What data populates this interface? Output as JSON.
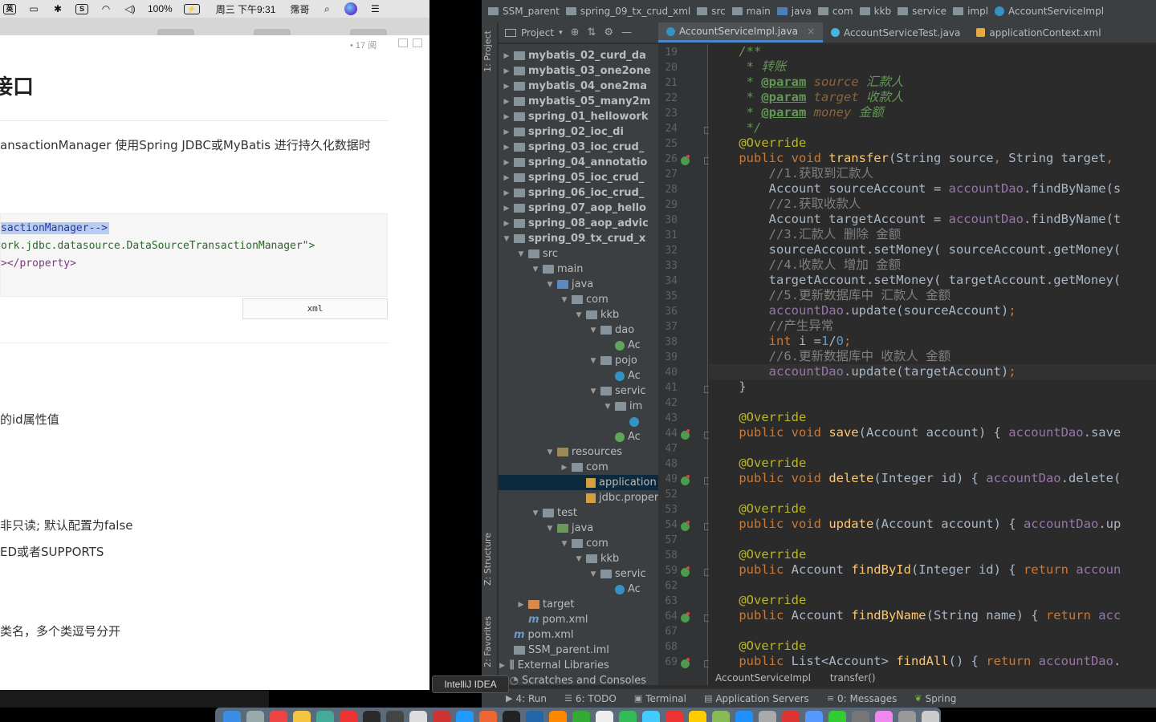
{
  "menubar": {
    "battery": "100%",
    "clock": "周三 下午9:31",
    "user": "霈哥",
    "icons": [
      "chinese-input-icon",
      "screen-icon",
      "bluetooth-icon",
      "s-app-icon",
      "wifi-icon",
      "volume-icon",
      "battery-icon",
      "search-icon",
      "siri-icon",
      "list-icon"
    ],
    "input_label": "英"
  },
  "doc": {
    "meta": "• 17 阅",
    "heading": "接口",
    "para1": "ansactionManager 使用Spring JDBC或MyBatis 进行持久化数据时",
    "code_lines": [
      "sactionManager-->",
      "ork.jdbc.datasource.DataSourceTransactionManager\">",
      "></property>"
    ],
    "code_lang": "xml",
    "para2": "的id属性值",
    "para3": "非只读; 默认配置为false",
    "para4": "ED或者SUPPORTS",
    "para5": "类名，多个类逗号分开"
  },
  "ide": {
    "breadcrumbs": [
      "SSM_parent",
      "spring_09_tx_crud_xml",
      "src",
      "main",
      "java",
      "com",
      "kkb",
      "service",
      "impl",
      "AccountServiceImpl"
    ],
    "project_label": "Project",
    "tabs": [
      {
        "label": "AccountServiceImpl.java",
        "active": true
      },
      {
        "label": "AccountServiceTest.java",
        "active": false
      },
      {
        "label": "applicationContext.xml",
        "active": false
      }
    ],
    "left_stripe": [
      "1: Project",
      "Z: Structure",
      "2: Favorites"
    ],
    "tree": [
      {
        "label": "mybatis_02_curd_da",
        "depth": 0,
        "arrow": "▶",
        "icon": "module"
      },
      {
        "label": "mybatis_03_one2one",
        "depth": 0,
        "arrow": "▶",
        "icon": "module"
      },
      {
        "label": "mybatis_04_one2ma",
        "depth": 0,
        "arrow": "▶",
        "icon": "module"
      },
      {
        "label": "mybatis_05_many2m",
        "depth": 0,
        "arrow": "▶",
        "icon": "module"
      },
      {
        "label": "spring_01_hellowork",
        "depth": 0,
        "arrow": "▶",
        "icon": "module"
      },
      {
        "label": "spring_02_ioc_di",
        "depth": 0,
        "arrow": "▶",
        "icon": "module"
      },
      {
        "label": "spring_03_ioc_crud_",
        "depth": 0,
        "arrow": "▶",
        "icon": "module"
      },
      {
        "label": "spring_04_annotatio",
        "depth": 0,
        "arrow": "▶",
        "icon": "module"
      },
      {
        "label": "spring_05_ioc_crud_",
        "depth": 0,
        "arrow": "▶",
        "icon": "module"
      },
      {
        "label": "spring_06_ioc_crud_",
        "depth": 0,
        "arrow": "▶",
        "icon": "module"
      },
      {
        "label": "spring_07_aop_hello",
        "depth": 0,
        "arrow": "▶",
        "icon": "module"
      },
      {
        "label": "spring_08_aop_advic",
        "depth": 0,
        "arrow": "▶",
        "icon": "module"
      },
      {
        "label": "spring_09_tx_crud_x",
        "depth": 0,
        "arrow": "▼",
        "icon": "module"
      },
      {
        "label": "src",
        "depth": 1,
        "arrow": "▼",
        "icon": "folder"
      },
      {
        "label": "main",
        "depth": 2,
        "arrow": "▼",
        "icon": "folder"
      },
      {
        "label": "java",
        "depth": 3,
        "arrow": "▼",
        "icon": "src"
      },
      {
        "label": "com",
        "depth": 4,
        "arrow": "▼",
        "icon": "pkg"
      },
      {
        "label": "kkb",
        "depth": 5,
        "arrow": "▼",
        "icon": "pkg"
      },
      {
        "label": "dao",
        "depth": 6,
        "arrow": "▼",
        "icon": "pkg"
      },
      {
        "label": "Ac",
        "depth": 7,
        "arrow": "",
        "icon": "interface"
      },
      {
        "label": "pojo",
        "depth": 6,
        "arrow": "▼",
        "icon": "pkg"
      },
      {
        "label": "Ac",
        "depth": 7,
        "arrow": "",
        "icon": "class"
      },
      {
        "label": "servic",
        "depth": 6,
        "arrow": "▼",
        "icon": "pkg"
      },
      {
        "label": "im",
        "depth": 7,
        "arrow": "▼",
        "icon": "pkg"
      },
      {
        "label": "",
        "depth": 8,
        "arrow": "",
        "icon": "class"
      },
      {
        "label": "Ac",
        "depth": 7,
        "arrow": "",
        "icon": "interface"
      },
      {
        "label": "resources",
        "depth": 3,
        "arrow": "▼",
        "icon": "res"
      },
      {
        "label": "com",
        "depth": 4,
        "arrow": "▶",
        "icon": "pkg"
      },
      {
        "label": "application",
        "depth": 5,
        "arrow": "",
        "icon": "xml",
        "selected": true
      },
      {
        "label": "jdbc.proper",
        "depth": 5,
        "arrow": "",
        "icon": "props"
      },
      {
        "label": "test",
        "depth": 2,
        "arrow": "▼",
        "icon": "folder"
      },
      {
        "label": "java",
        "depth": 3,
        "arrow": "▼",
        "icon": "test"
      },
      {
        "label": "com",
        "depth": 4,
        "arrow": "▼",
        "icon": "pkg"
      },
      {
        "label": "kkb",
        "depth": 5,
        "arrow": "▼",
        "icon": "pkg"
      },
      {
        "label": "servic",
        "depth": 6,
        "arrow": "▼",
        "icon": "pkg"
      },
      {
        "label": "Ac",
        "depth": 7,
        "arrow": "",
        "icon": "class"
      },
      {
        "label": "target",
        "depth": 1,
        "arrow": "▶",
        "icon": "orange"
      },
      {
        "label": "pom.xml",
        "depth": 1,
        "arrow": "",
        "icon": "maven"
      },
      {
        "label": "pom.xml",
        "depth": 0,
        "arrow": "",
        "icon": "maven"
      },
      {
        "label": "SSM_parent.iml",
        "depth": 0,
        "arrow": "",
        "icon": "iml"
      },
      {
        "label": "External Libraries",
        "depth": -1,
        "arrow": "▶",
        "icon": "lib"
      },
      {
        "label": "Scratches and Consoles",
        "depth": -1,
        "arrow": "",
        "icon": "scratch"
      }
    ],
    "line_numbers": [
      "19",
      "20",
      "21",
      "22",
      "23",
      "24",
      "25",
      "26",
      "27",
      "28",
      "29",
      "30",
      "31",
      "32",
      "33",
      "34",
      "35",
      "36",
      "37",
      "38",
      "39",
      "40",
      "41",
      "42",
      "43",
      "44",
      "47",
      "48",
      "49",
      "52",
      "53",
      "54",
      "57",
      "58",
      "59",
      "62",
      "63",
      "64",
      "67",
      "68",
      "69"
    ],
    "code_breadcrumb": [
      "AccountServiceImpl",
      "transfer()"
    ],
    "bottom_tools": [
      {
        "key": "4",
        "label": "4: Run",
        "icon": "run-icon"
      },
      {
        "key": "6",
        "label": "6: TODO",
        "icon": "todo-icon"
      },
      {
        "key": "",
        "label": "Terminal",
        "icon": "terminal-icon"
      },
      {
        "key": "",
        "label": "Application Servers",
        "icon": "servers-icon"
      },
      {
        "key": "0",
        "label": "0: Messages",
        "icon": "messages-icon"
      },
      {
        "key": "",
        "label": "Spring",
        "icon": "spring-icon"
      }
    ],
    "tooltip": "IntelliJ IDEA"
  },
  "colors": {
    "keyword": "#cc7832",
    "annotation": "#bbb529",
    "method": "#ffc66d",
    "field": "#9876aa",
    "comment": "#808080",
    "javadoc": "#629755",
    "number": "#6897bb",
    "ide_bg": "#2b2b2b"
  }
}
